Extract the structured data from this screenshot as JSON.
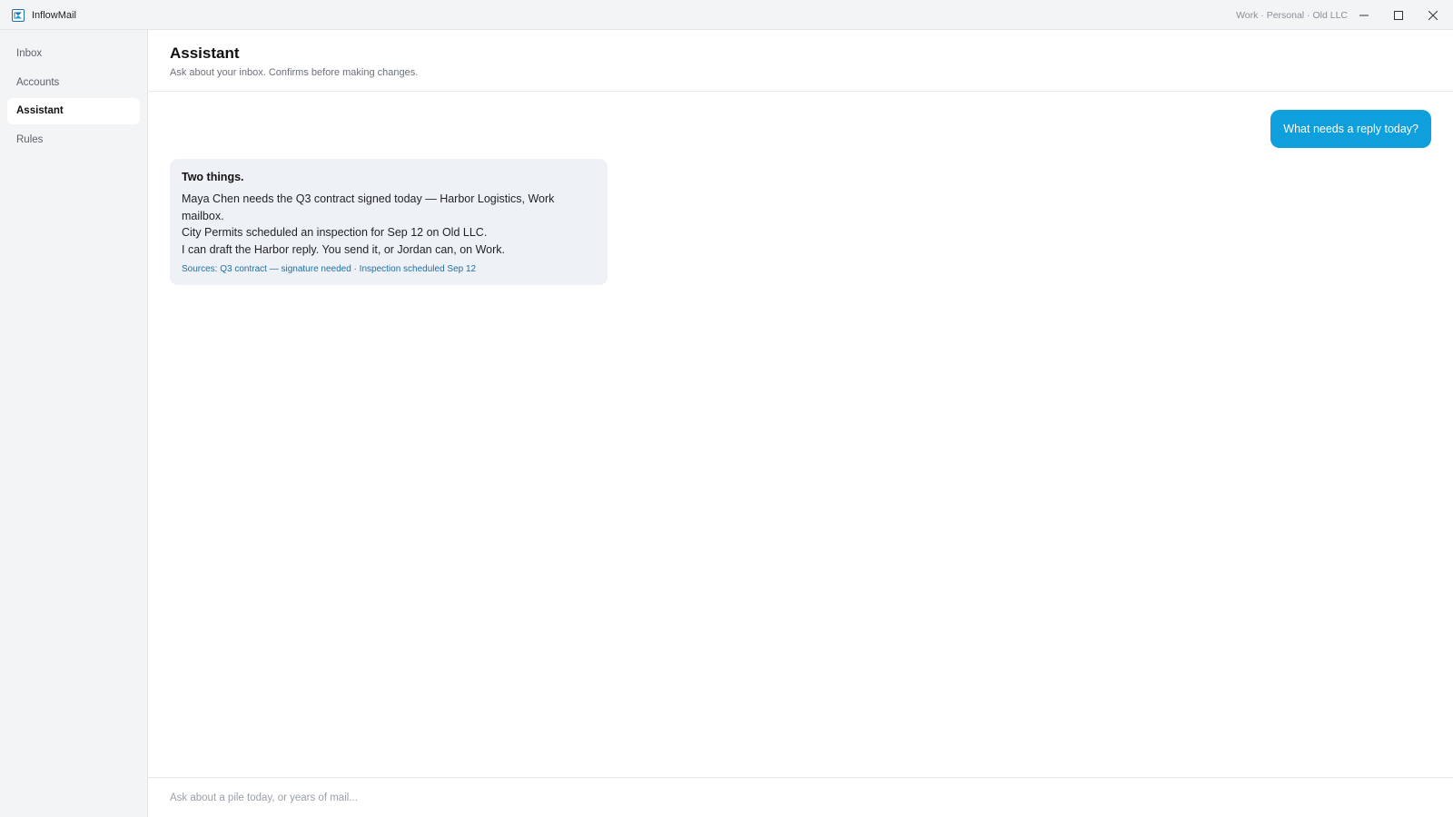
{
  "app": {
    "name": "InflowMail",
    "icon": "inflowmail-logo-icon",
    "accounts_label": "Work · Personal · Old LLC"
  },
  "window_controls": {
    "minimize_icon": "minimize-icon",
    "maximize_icon": "maximize-icon",
    "close_icon": "close-icon"
  },
  "sidebar": {
    "items": [
      {
        "label": "Inbox",
        "active": false
      },
      {
        "label": "Accounts",
        "active": false
      },
      {
        "label": "Assistant",
        "active": true
      },
      {
        "label": "Rules",
        "active": false
      }
    ]
  },
  "header": {
    "title": "Assistant",
    "subtitle": "Ask about your inbox. Confirms before making changes."
  },
  "chat": {
    "user_message": "What needs a reply today?",
    "assistant": {
      "heading": "Two things.",
      "lines": [
        "Maya Chen needs the Q3 contract signed today — Harbor Logistics, Work mailbox.",
        "City Permits scheduled an inspection for Sep 12 on Old LLC.",
        "I can draft the Harbor reply. You send it, or Jordan can, on Work."
      ],
      "sources_prefix": "Sources: ",
      "sources": [
        "Q3 contract — signature needed",
        "Inspection scheduled Sep 12"
      ],
      "sources_separator": " · "
    }
  },
  "composer": {
    "placeholder": "Ask about a pile today, or years of mail..."
  },
  "colors": {
    "accent": "#0f9fdc",
    "link": "#1e6fa6",
    "sidebar_bg": "#f3f4f6",
    "assistant_bubble_bg": "#eef1f5"
  }
}
